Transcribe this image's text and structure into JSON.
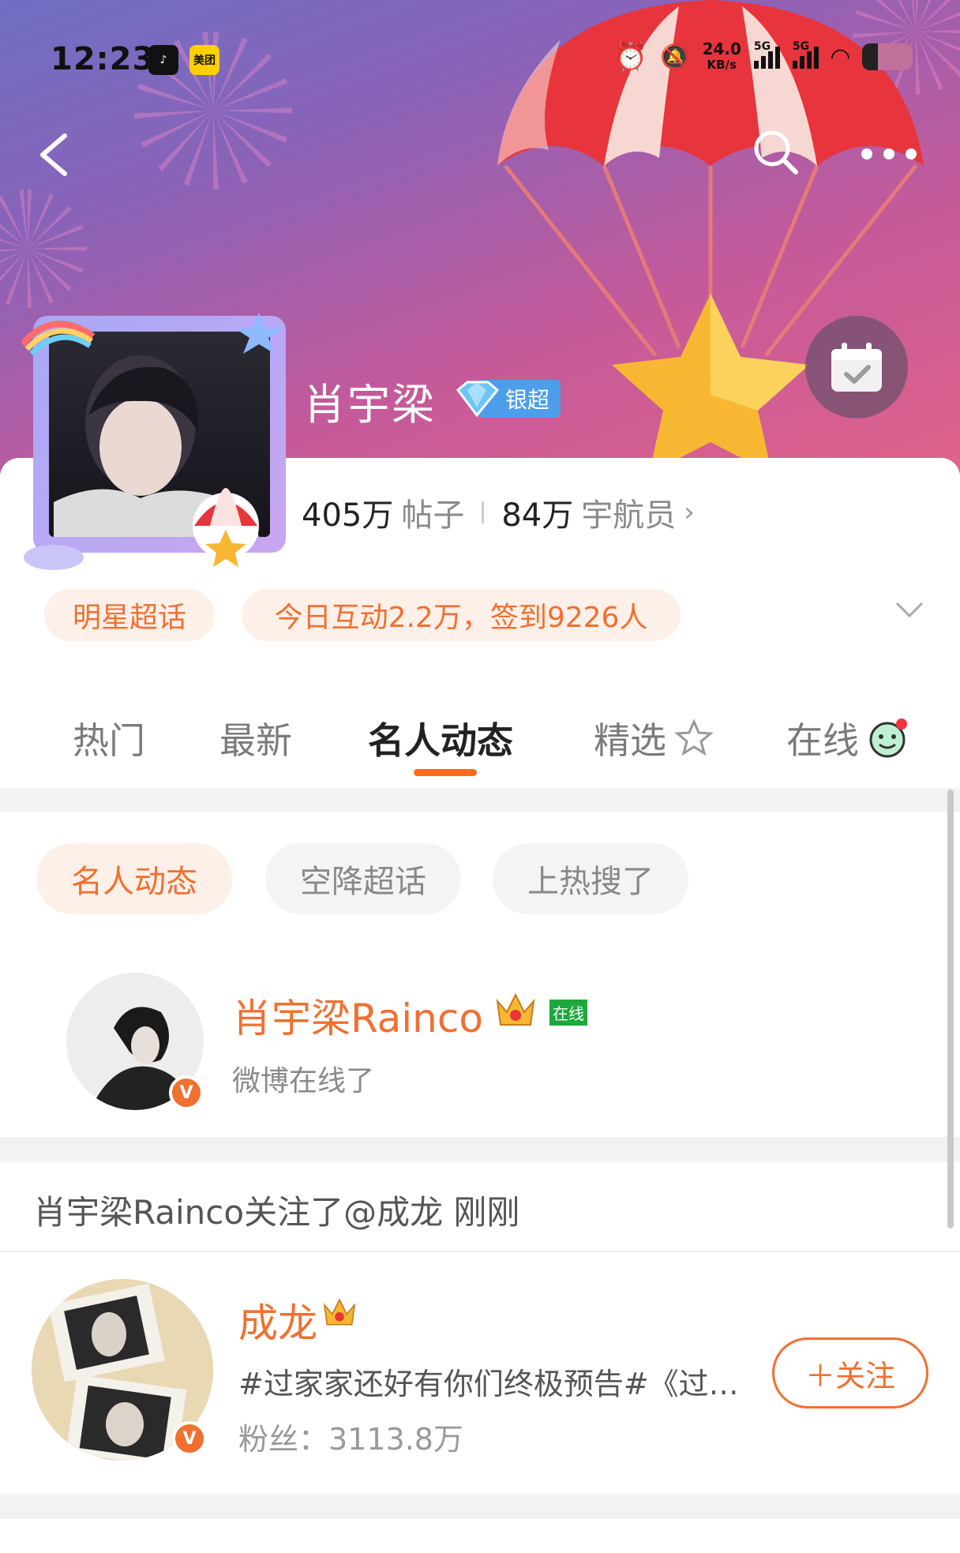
{
  "status_bar": {
    "time": "12:23",
    "app_badges": [
      "tiktok-icon",
      "美团"
    ],
    "net_speed": "24.0",
    "net_unit": "KB/s",
    "signal1": "5G",
    "signal2": "5G"
  },
  "header": {
    "back_icon": "chevron-left-icon",
    "search_icon": "search-icon",
    "more_icon": "more-dots-icon",
    "checkin_icon": "calendar-check-icon"
  },
  "topic": {
    "name": "肖宇梁",
    "tier_label": "银超",
    "posts_count": "405万",
    "posts_label": "帖子",
    "members_count": "84万",
    "members_label": "宇航员",
    "category_pill": "明星超话",
    "activity_pill": "今日互动2.2万，签到9226人"
  },
  "tabs": [
    {
      "label": "热门"
    },
    {
      "label": "最新"
    },
    {
      "label": "名人动态"
    },
    {
      "label": "精选"
    },
    {
      "label": "在线"
    }
  ],
  "filter_chips": [
    {
      "label": "名人动态"
    },
    {
      "label": "空降超话"
    },
    {
      "label": "上热搜了"
    }
  ],
  "celebrity": {
    "name": "肖宇梁Rainco",
    "online_tag": "在线",
    "status": "微博在线了",
    "verified_mark": "V"
  },
  "activity": {
    "notice": "肖宇梁Rainco关注了@成龙 刚刚",
    "user_name": "成龙",
    "description": "#过家家还好有你们终极预告#《过…",
    "fans": "粉丝：3113.8万",
    "follow_label": "＋关注",
    "verified_mark": "V"
  },
  "colors": {
    "accent": "#f07030",
    "pill_bg": "#fdf0e8",
    "tier_blue": "#4d9eea",
    "online_green": "#1ca83c"
  }
}
